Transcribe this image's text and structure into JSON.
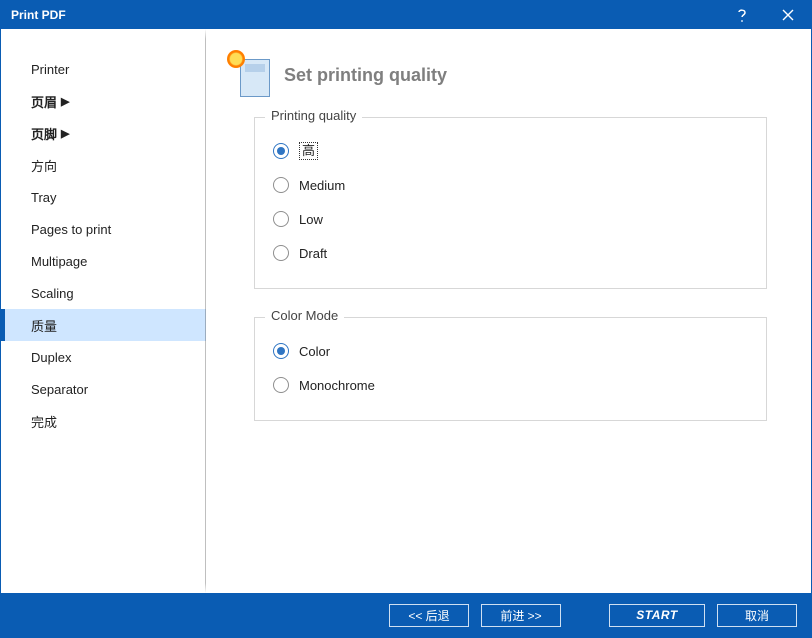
{
  "window": {
    "title": "Print PDF"
  },
  "sidebar": {
    "items": [
      {
        "label": "Printer",
        "cjk": false,
        "expandable": false
      },
      {
        "label": "页眉",
        "cjk": true,
        "expandable": true
      },
      {
        "label": "页脚",
        "cjk": true,
        "expandable": true
      },
      {
        "label": "方向",
        "cjk": false,
        "expandable": false
      },
      {
        "label": "Tray",
        "cjk": false,
        "expandable": false
      },
      {
        "label": "Pages to print",
        "cjk": false,
        "expandable": false
      },
      {
        "label": "Multipage",
        "cjk": false,
        "expandable": false
      },
      {
        "label": "Scaling",
        "cjk": false,
        "expandable": false
      },
      {
        "label": "质量",
        "cjk": false,
        "expandable": false,
        "active": true
      },
      {
        "label": "Duplex",
        "cjk": false,
        "expandable": false
      },
      {
        "label": "Separator",
        "cjk": false,
        "expandable": false
      },
      {
        "label": "完成",
        "cjk": false,
        "expandable": false
      }
    ]
  },
  "main": {
    "title": "Set printing quality",
    "quality_legend": "Printing quality",
    "quality_options": [
      {
        "label": "高",
        "checked": true,
        "boxed": true
      },
      {
        "label": "Medium",
        "checked": false,
        "boxed": false
      },
      {
        "label": "Low",
        "checked": false,
        "boxed": false
      },
      {
        "label": "Draft",
        "checked": false,
        "boxed": false
      }
    ],
    "color_legend": "Color Mode",
    "color_options": [
      {
        "label": "Color",
        "checked": true
      },
      {
        "label": "Monochrome",
        "checked": false
      }
    ]
  },
  "footer": {
    "back": "<<  后退",
    "next": "前进  >>",
    "start": "START",
    "cancel": "取消"
  }
}
